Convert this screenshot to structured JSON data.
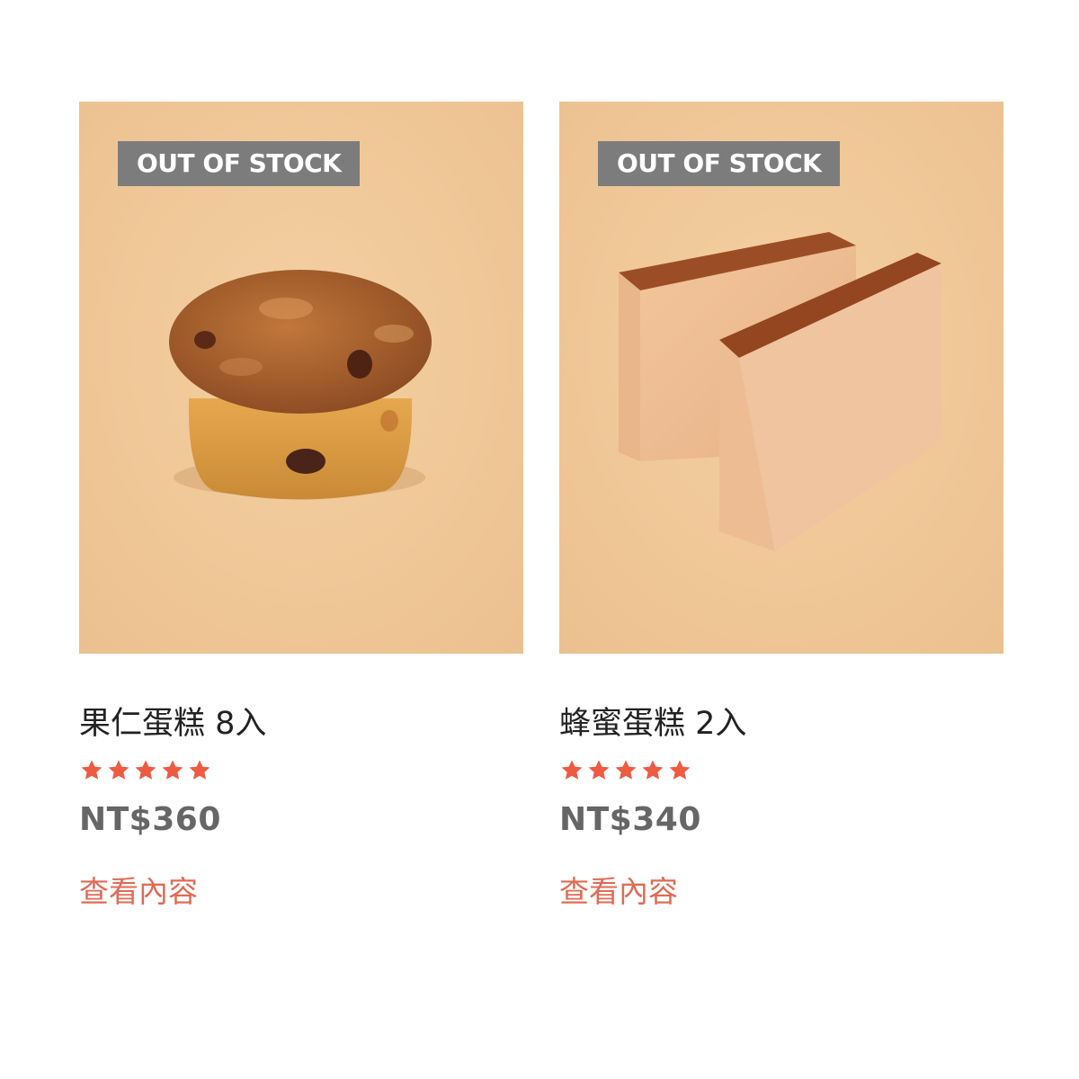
{
  "products": [
    {
      "badge": "OUT OF STOCK",
      "image": "walnut-cake-photo",
      "name": "果仁蛋糕 8入",
      "rating": 5,
      "rating_max": 5,
      "price": "NT$360",
      "link_label": "查看內容"
    },
    {
      "badge": "OUT OF STOCK",
      "image": "castella-cake-photo",
      "name": "蜂蜜蛋糕 2入",
      "rating": 5,
      "rating_max": 5,
      "price": "NT$340",
      "link_label": "查看內容"
    }
  ],
  "colors": {
    "photo_background": "#f0c899",
    "badge_background": "#7c7c7c",
    "star": "#ef5a43",
    "link": "#e06b55",
    "price": "#666666"
  }
}
